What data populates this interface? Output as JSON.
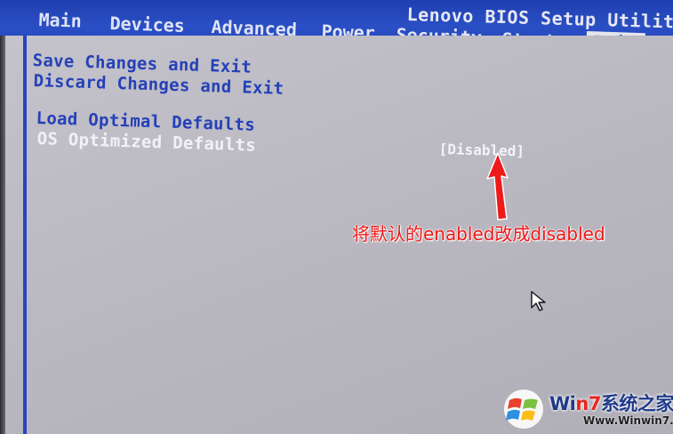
{
  "header": {
    "title": "Lenovo BIOS Setup Utility",
    "tabs": [
      {
        "label": "Main",
        "active": false
      },
      {
        "label": "Devices",
        "active": false
      },
      {
        "label": "Advanced",
        "active": false
      },
      {
        "label": "Power",
        "active": false
      },
      {
        "label": "Security",
        "active": false
      },
      {
        "label": "Startup",
        "active": false
      },
      {
        "label": "Exit",
        "active": true
      }
    ]
  },
  "menu": {
    "items": [
      {
        "label": "Save Changes and Exit",
        "selected": false
      },
      {
        "label": "Discard Changes and Exit",
        "selected": false
      },
      {
        "label": "Load Optimal Defaults",
        "selected": false
      },
      {
        "label": "OS Optimized Defaults",
        "selected": true
      }
    ],
    "selected_value": "[Disabled]"
  },
  "annotation": {
    "text": "将默认的enabled改成disabled",
    "color": "#f01616"
  },
  "watermark": {
    "brand_prefix": "Wi",
    "brand_number": "n7",
    "brand_suffix": "系统之家",
    "url": "Www.Winwin7.com"
  },
  "colors": {
    "header_blue": "#2a4fc4",
    "menu_text_blue": "#2541b8",
    "panel_gray": "#bab8c0",
    "annotation_red": "#f01616"
  },
  "icons": [
    "arrow-icon",
    "mouse-cursor-icon",
    "windows-logo-icon"
  ]
}
